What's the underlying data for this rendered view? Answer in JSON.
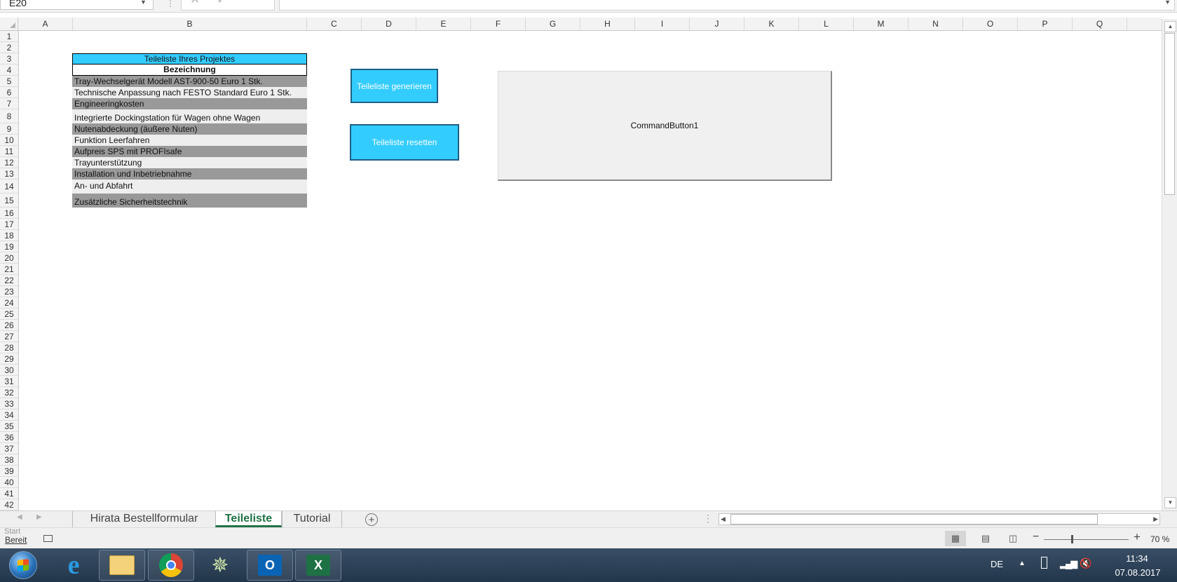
{
  "formula_bar": {
    "name_box": "E20",
    "cancel_icon": "close-icon",
    "enter_icon": "checkmark-icon",
    "fx_label": "fx",
    "formula": ""
  },
  "columns": [
    "A",
    "B",
    "C",
    "D",
    "E",
    "F",
    "G",
    "H",
    "I",
    "J",
    "K",
    "L",
    "M",
    "N",
    "O",
    "P",
    "Q"
  ],
  "rows": [
    "1",
    "2",
    "3",
    "4",
    "5",
    "6",
    "7",
    "8",
    "9",
    "10",
    "11",
    "12",
    "13",
    "14",
    "15",
    "16",
    "17",
    "18",
    "19",
    "20",
    "21",
    "22",
    "23",
    "24",
    "25",
    "26",
    "27",
    "28",
    "29",
    "30",
    "31",
    "32",
    "33",
    "34",
    "35",
    "36",
    "37",
    "38",
    "39",
    "40",
    "41",
    "42"
  ],
  "table": {
    "title": "Teileliste Ihres Projektes",
    "header": "Bezeichnung",
    "items": [
      "Tray-Wechselgerät Modell AST-900-50 Euro 1 Stk.",
      "Technische Anpassung nach FESTO Standard Euro 1 Stk.",
      "Engineeringkosten",
      "Integrierte Dockingstation für Wagen ohne Wagen",
      "Nutenabdeckung (äußere Nuten)",
      "Funktion Leerfahren",
      "Aufpreis SPS mit PROFIsafe",
      "Trayunterstützung",
      "Installation und Inbetriebnahme",
      "An- und Abfahrt",
      "Zusätzliche Sicherheitstechnik"
    ],
    "title_color": "#33ccff",
    "stripe_dark": "#999999",
    "stripe_light": "#eeeeee"
  },
  "buttons": {
    "generate": "Teileliste generieren",
    "reset": "Teileliste resetten",
    "command1": "CommandButton1",
    "button_color": "#33ccff"
  },
  "sheet_tabs": {
    "tabs": [
      "Hirata Bestellformular",
      "Teileliste",
      "Tutorial"
    ],
    "active": "Teileliste",
    "add_icon": "plus-icon",
    "active_color": "#217346"
  },
  "status_bar": {
    "status": "Bereit",
    "start_hint": "Start",
    "zoom": "70 %",
    "zoom_minus": "−",
    "zoom_plus": "+",
    "view_icons": [
      "normal-view-icon",
      "page-layout-icon",
      "page-break-icon"
    ],
    "active_view": "normal-view-icon"
  },
  "taskbar": {
    "apps": [
      "windows-start-icon",
      "internet-explorer-icon",
      "file-explorer-icon",
      "chrome-icon",
      "tool-icon",
      "outlook-icon",
      "excel-icon"
    ],
    "outlook_label": "O",
    "excel_label": "X",
    "ie_label": "e",
    "language": "DE",
    "time": "11:34",
    "date": "07.08.2017"
  }
}
